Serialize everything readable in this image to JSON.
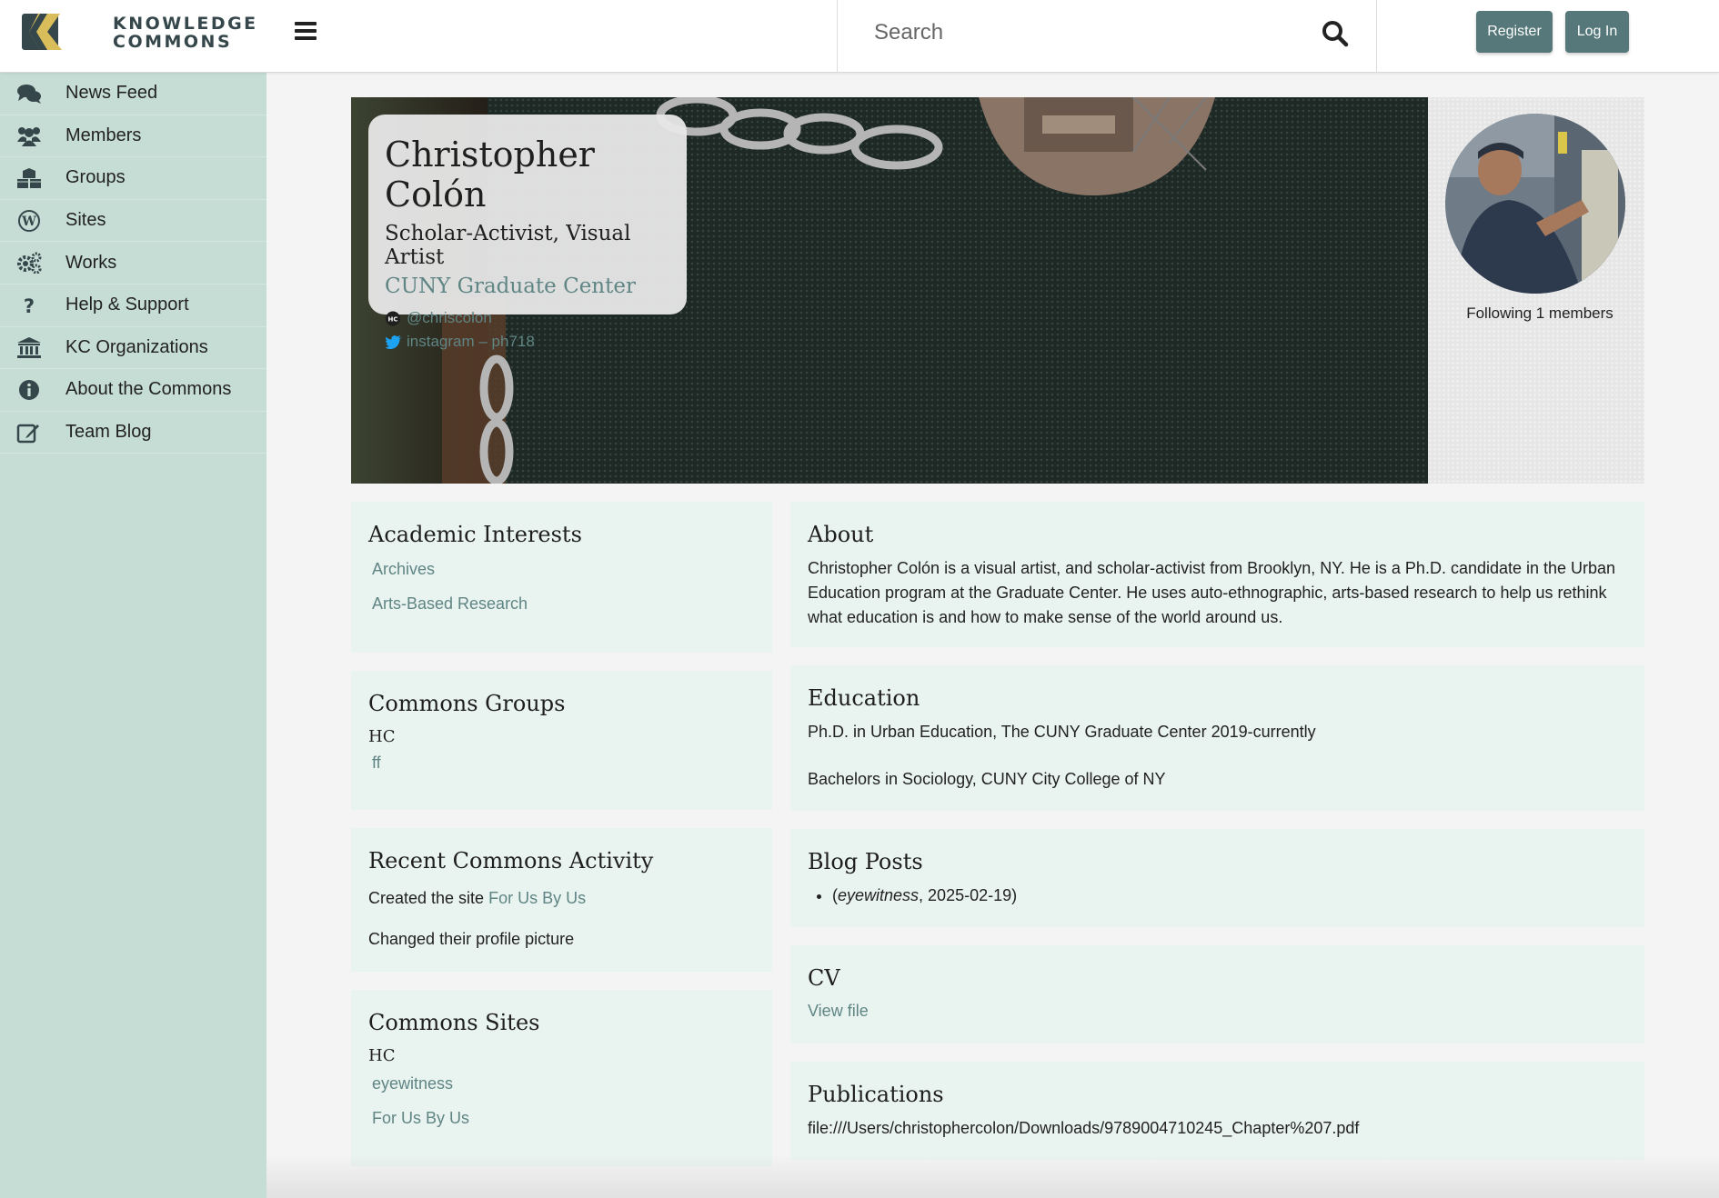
{
  "header": {
    "logo_line1": "KNOWLEDGE",
    "logo_line2": "COMMONS",
    "menu_icon": "hamburger-icon",
    "search_placeholder": "Search",
    "register_label": "Register",
    "login_label": "Log In"
  },
  "sidebar": {
    "items": [
      {
        "label": "News Feed",
        "icon": "comments-icon"
      },
      {
        "label": "Members",
        "icon": "users-icon"
      },
      {
        "label": "Groups",
        "icon": "cubes-icon"
      },
      {
        "label": "Sites",
        "icon": "wordpress-icon"
      },
      {
        "label": "Works",
        "icon": "cogs-icon"
      },
      {
        "label": "Help & Support",
        "icon": "question-icon"
      },
      {
        "label": "KC Organizations",
        "icon": "institution-icon"
      },
      {
        "label": "About the Commons",
        "icon": "info-icon"
      },
      {
        "label": "Team Blog",
        "icon": "edit-icon"
      }
    ]
  },
  "profile": {
    "name": "Christopher Colón",
    "title": "Scholar-Activist, Visual Artist",
    "institution": "CUNY Graduate Center",
    "hc_handle": "@chriscolon",
    "twitter": "instagram – ph718",
    "following": "Following 1 members"
  },
  "interests": {
    "heading": "Academic Interests",
    "items": [
      "Archives",
      "Arts-Based Research"
    ]
  },
  "groups": {
    "heading": "Commons Groups",
    "network": "HC",
    "items": [
      "ff"
    ]
  },
  "activity": {
    "heading": "Recent Commons Activity",
    "item1_prefix": "Created the site",
    "item1_link": "For Us By Us",
    "item2": "Changed their profile picture"
  },
  "sites": {
    "heading": "Commons Sites",
    "network": "HC",
    "items": [
      "eyewitness",
      "For Us By Us"
    ]
  },
  "about": {
    "heading": "About",
    "text": "Christopher Colón is a visual artist, and scholar-activist from Brooklyn, NY. He is a Ph.D. candidate in the Urban Education program at the Graduate Center. He uses auto-ethnographic, arts-based research to help us rethink what education is and how to make sense of the world around us."
  },
  "education": {
    "heading": "Education",
    "line1": "Ph.D. in Urban Education, The CUNY Graduate Center 2019-currently",
    "line2": "Bachelors in Sociology, CUNY City College of NY"
  },
  "blog": {
    "heading": "Blog Posts",
    "post_open": "(",
    "post_site": "eyewitness",
    "post_date": ", 2025-02-19)"
  },
  "cv": {
    "heading": "CV",
    "link": "View file"
  },
  "publications": {
    "heading": "Publications",
    "text": "file:///Users/christophercolon/Downloads/9789004710245_Chapter%207.pdf"
  },
  "colors": {
    "sidebar_bg": "#c6ddd6",
    "panel_bg": "#e9f3ef",
    "accent_link": "#5f8584",
    "button_bg": "#56787a",
    "logo_gold": "#d8bd5a"
  }
}
